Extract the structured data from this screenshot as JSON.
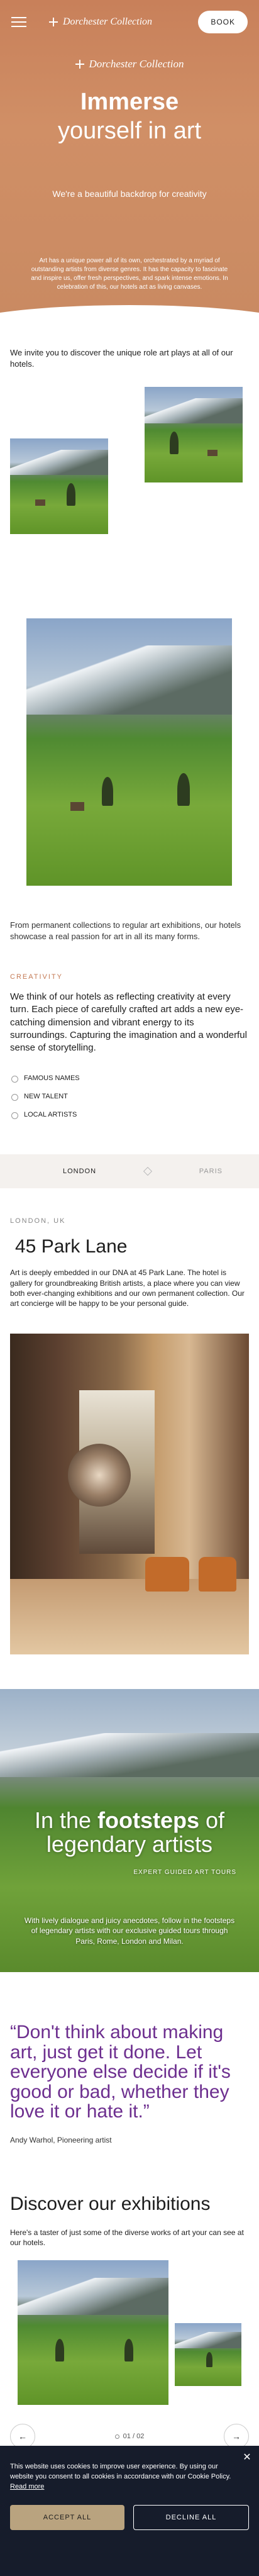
{
  "header": {
    "brand": "Dorchester Collection",
    "book_label": "BOOK"
  },
  "hero": {
    "logo_text": "Dorchester Collection",
    "title_line1": "Immerse",
    "title_line2": "yourself in art",
    "subtitle": "We're a beautiful backdrop for creativity",
    "body": "Art has a unique power all of its own, orchestrated by a myriad of outstanding artists from diverse genres. It has the capacity to fascinate and inspire us, offer fresh perspectives, and spark intense emotions. In celebration of this, our hotels act as living canvases."
  },
  "intro": {
    "text": "We invite you to discover the unique role art plays at all of our hotels.",
    "caption": "From permanent collections to regular art exhibitions, our hotels showcase a real passion for art in all its many forms."
  },
  "creativity": {
    "eyebrow": "CREATIVITY",
    "body": "We think of our hotels as reflecting creativity at every turn. Each piece of carefully crafted art adds a new eye-catching dimension and vibrant energy to its surroundings. Capturing the imagination and a wonderful sense of storytelling.",
    "features": [
      "FAMOUS NAMES",
      "NEW TALENT",
      "LOCAL ARTISTS"
    ]
  },
  "location_tabs": {
    "tabs": [
      "LONDON",
      "PARIS"
    ],
    "active": "LONDON"
  },
  "location": {
    "eyebrow": "LONDON, UK",
    "title": "45 Park Lane",
    "body": "Art is deeply embedded in our DNA at 45 Park Lane. The hotel is gallery for groundbreaking British artists, a place where you can view both ever-changing exhibitions and our own permanent collection. Our art concierge will be happy to be your personal guide."
  },
  "footsteps": {
    "title_pre": "In the ",
    "title_bold": "footsteps",
    "title_post": " of legendary artists",
    "tag": "EXPERT GUIDED ART TOURS",
    "body": "With lively dialogue and juicy anecdotes, follow in the footsteps of legendary artists with our exclusive guided tours through Paris, Rome, London and Milan."
  },
  "quote": {
    "text": "“Don't think about making art, just get it done. Let everyone else decide if it's good or bad, whether they love it or hate it.”",
    "author": "Andy Warhol, Pioneering artist"
  },
  "exhibitions": {
    "title": "Discover our exhibitions",
    "body": "Here's a taster of just some of the diverse works of art your can see at our hotels.",
    "pager": "01 / 02",
    "prev_icon": "arrow-left-icon",
    "next_icon": "arrow-right-icon"
  },
  "cookie": {
    "text": "This website uses cookies to improve user experience. By using our website you consent to all cookies in accordance with our Cookie Policy.",
    "read_more": "Read more",
    "accept": "ACCEPT ALL",
    "decline": "DECLINE ALL"
  },
  "colors": {
    "hero_bg": "#c8805a",
    "accent": "#c47a55",
    "quote": "#6d2f8f",
    "cookie_bg": "#161c2b",
    "accept_bg": "#b9a37f"
  }
}
